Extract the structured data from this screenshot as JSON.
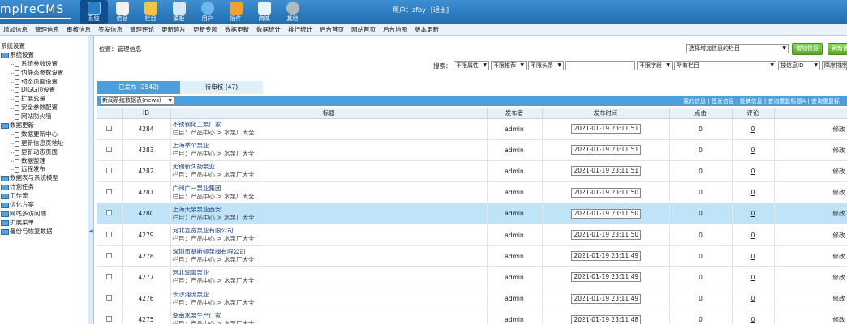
{
  "header": {
    "logo": "mpireCMS",
    "nav": [
      "系统",
      "信息",
      "栏目",
      "模板",
      "用户",
      "插件",
      "商城",
      "其他"
    ],
    "user_prefix": "用户：",
    "user": "zfby",
    "logout": "[退出]"
  },
  "submenu": [
    "增加信息",
    "管理信息",
    "审核信息",
    "签发信息",
    "管理评论",
    "更新碎片",
    "更新专题",
    "数据更新",
    "数据统计",
    "排行统计",
    "后台首页",
    "网站首页",
    "后台地图",
    "版本更新"
  ],
  "sidebar": {
    "nodes": [
      {
        "label": "系统设置",
        "level": 0,
        "type": "plain"
      },
      {
        "label": "系统设置",
        "level": 0,
        "type": "folder"
      },
      {
        "label": "系统参数设置",
        "level": 1,
        "type": "doc"
      },
      {
        "label": "伪静态参数设置",
        "level": 1,
        "type": "doc"
      },
      {
        "label": "动态页面设置",
        "level": 1,
        "type": "doc"
      },
      {
        "label": "DIGG顶设置",
        "level": 1,
        "type": "doc"
      },
      {
        "label": "扩展变量",
        "level": 1,
        "type": "doc"
      },
      {
        "label": "安全参数配置",
        "level": 1,
        "type": "doc"
      },
      {
        "label": "网站防火墙",
        "level": 1,
        "type": "doc"
      },
      {
        "label": "数据更新",
        "level": 0,
        "type": "folder"
      },
      {
        "label": "数据更新中心",
        "level": 1,
        "type": "doc"
      },
      {
        "label": "更新信息页地址",
        "level": 1,
        "type": "doc"
      },
      {
        "label": "更新动态页面",
        "level": 1,
        "type": "doc"
      },
      {
        "label": "数据整理",
        "level": 1,
        "type": "doc"
      },
      {
        "label": "远程发布",
        "level": 1,
        "type": "doc"
      },
      {
        "label": "数据表与系统模型",
        "level": 0,
        "type": "folder"
      },
      {
        "label": "计划任务",
        "level": 0,
        "type": "folder"
      },
      {
        "label": "工作流",
        "level": 0,
        "type": "folder"
      },
      {
        "label": "优化方案",
        "level": 0,
        "type": "folder"
      },
      {
        "label": "网站多访问端",
        "level": 0,
        "type": "folder"
      },
      {
        "label": "扩展菜单",
        "level": 0,
        "type": "folder"
      },
      {
        "label": "备份与恢复数据",
        "level": 0,
        "type": "folder"
      }
    ]
  },
  "main": {
    "location": "位置：管理信息",
    "add_select": "选择增加信息的栏目",
    "add_button": "增加信息",
    "refresh_button": "刷新首",
    "search": {
      "label": "搜索：",
      "attr": "不限属性",
      "recommend": "不限推荐",
      "headline": "不限头条",
      "field": "不限字段",
      "column": "所有栏目",
      "sort": "按信息ID",
      "order": "降序排序"
    },
    "tabs": {
      "published": "已发布 (2542)",
      "pending": "待审核 (47)"
    },
    "table_select": "新闻系统数据表(news)",
    "table_links": "我的信息 | 签发信息 | 投稿信息 | 查询重复标题A | 查询重复标",
    "columns": [
      "",
      "ID",
      "标题",
      "发布者",
      "发布时间",
      "点击",
      "评论",
      ""
    ],
    "rows": [
      {
        "id": "4284",
        "title": "不锈钢化工泵厂家",
        "cat": "栏目：产品中心 > 水泵厂大全",
        "author": "admin",
        "time": "2021-01-19 23:11:51",
        "clicks": "0",
        "comments": "0",
        "op": "修改"
      },
      {
        "id": "4283",
        "title": "上海季个泵业",
        "cat": "栏目：产品中心 > 水泵厂大全",
        "author": "admin",
        "time": "2021-01-19 23:11:51",
        "clicks": "0",
        "comments": "0",
        "op": "修改"
      },
      {
        "id": "4282",
        "title": "无锡新久扬泵业",
        "cat": "栏目：产品中心 > 水泵厂大全",
        "author": "admin",
        "time": "2021-01-19 23:11:51",
        "clicks": "0",
        "comments": "0",
        "op": "修改"
      },
      {
        "id": "4281",
        "title": "广州广一泵业集团",
        "cat": "栏目：产品中心 > 水泵厂大全",
        "author": "admin",
        "time": "2021-01-19 23:11:50",
        "clicks": "0",
        "comments": "0",
        "op": "修改"
      },
      {
        "id": "4280",
        "title": "上海天泉泵业西安",
        "cat": "栏目：产品中心 > 水泵厂大全",
        "author": "admin",
        "time": "2021-01-19 23:11:50",
        "clicks": "0",
        "comments": "0",
        "op": "修改"
      },
      {
        "id": "4279",
        "title": "河北宣宽泵业有限公司",
        "cat": "栏目：产品中心 > 水泵厂大全",
        "author": "admin",
        "time": "2021-01-19 23:11:50",
        "clicks": "0",
        "comments": "0",
        "op": "修改"
      },
      {
        "id": "4278",
        "title": "深圳市基斯顿泵阀有限公司",
        "cat": "栏目：产品中心 > 水泵厂大全",
        "author": "admin",
        "time": "2021-01-19 23:11:49",
        "clicks": "0",
        "comments": "0",
        "op": "修改"
      },
      {
        "id": "4277",
        "title": "河北润豪泵业",
        "cat": "栏目：产品中心 > 水泵厂大全",
        "author": "admin",
        "time": "2021-01-19 23:11:49",
        "clicks": "0",
        "comments": "0",
        "op": "修改"
      },
      {
        "id": "4276",
        "title": "长沙湘流泵业",
        "cat": "栏目：产品中心 > 水泵厂大全",
        "author": "admin",
        "time": "2021-01-19 23:11:49",
        "clicks": "0",
        "comments": "0",
        "op": "修改"
      },
      {
        "id": "4275",
        "title": "湖南水泵生产厂家",
        "cat": "栏目：产品中心 > 水泵厂大全",
        "author": "admin",
        "time": "2021-01-19 23:11:48",
        "clicks": "0",
        "comments": "0",
        "op": "修改"
      }
    ],
    "highlight_row": 4
  },
  "colors": {
    "header": "#1f6cb0",
    "tab_active": "#4b9fdc",
    "highlight": "#bfe3f7",
    "button_green": "#56a82a"
  }
}
